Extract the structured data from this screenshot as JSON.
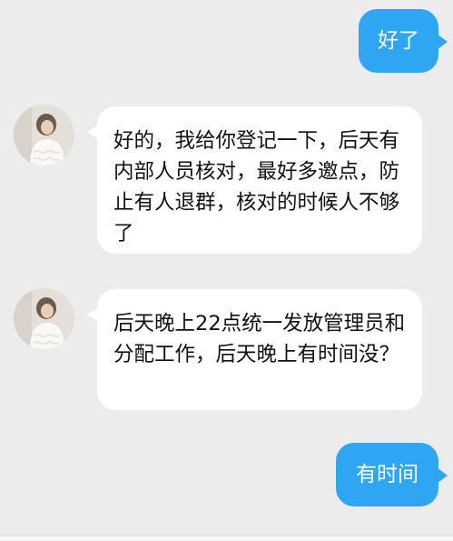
{
  "colors": {
    "background": "#ececec",
    "outgoing_bubble": "#2fa6f2",
    "outgoing_text": "#ffffff",
    "incoming_bubble": "#ffffff",
    "incoming_text": "#111111"
  },
  "messages": [
    {
      "direction": "outgoing",
      "text": "好了"
    },
    {
      "direction": "incoming",
      "avatar": "contact-avatar-photo",
      "text": "好的，我给你登记一下，后天有内部人员核对，最好多邀点，防止有人退群，核对的时候人不够了"
    },
    {
      "direction": "incoming",
      "avatar": "contact-avatar-photo",
      "text": "后天晚上22点统一发放管理员和分配工作，后天晚上有时间没？"
    },
    {
      "direction": "outgoing",
      "text": "有时间"
    }
  ]
}
